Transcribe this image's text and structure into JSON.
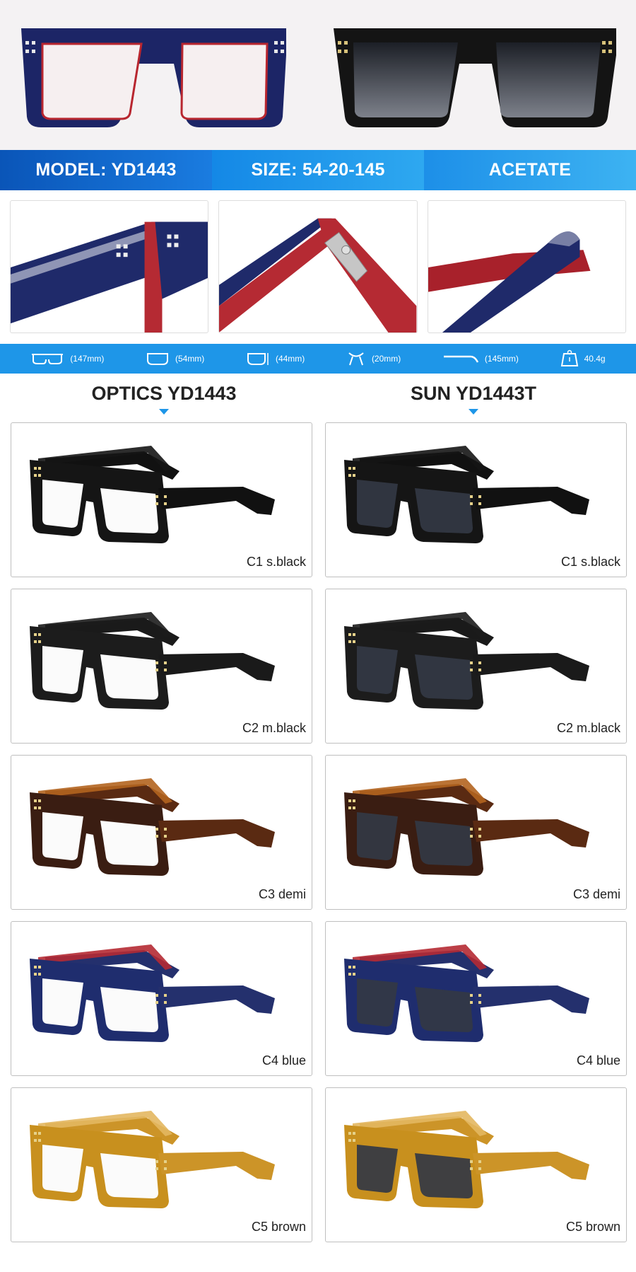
{
  "banner": {
    "model": "MODEL: YD1443",
    "size": "SIZE: 54-20-145",
    "material": "ACETATE"
  },
  "measurements": [
    {
      "icon": "frame-width-icon",
      "value": "(147mm)"
    },
    {
      "icon": "lens-width-icon",
      "value": "(54mm)"
    },
    {
      "icon": "lens-height-icon",
      "value": "(44mm)"
    },
    {
      "icon": "bridge-icon",
      "value": "(20mm)"
    },
    {
      "icon": "temple-length-icon",
      "value": "(145mm)"
    },
    {
      "icon": "weight-scale-icon",
      "value": "40.4g"
    }
  ],
  "columns": {
    "optics": "OPTICS YD1443",
    "sun": "SUN YD1443T"
  },
  "variants": [
    {
      "label": "C1 s.black",
      "frame": "#151515",
      "temple": "#111111",
      "accent": "#151515"
    },
    {
      "label": "C2 m.black",
      "frame": "#1c1c1c",
      "temple": "#1a1a1a",
      "accent": "#1c1c1c"
    },
    {
      "label": "C3 demi",
      "frame": "#3a1d12",
      "temple": "#5a2a12",
      "accent": "#b2641f"
    },
    {
      "label": "C4 blue",
      "frame": "#1f2d6e",
      "temple": "#24306d",
      "accent": "#b52a33"
    },
    {
      "label": "C5 brown",
      "frame": "#c8901e",
      "temple": "#cc9428",
      "accent": "#e3b760"
    }
  ],
  "colors": {
    "banner_blue": "#1e96e8",
    "lens_sun": "#333844",
    "hero_blue": "#1c2566",
    "hero_red": "#b8262f"
  }
}
